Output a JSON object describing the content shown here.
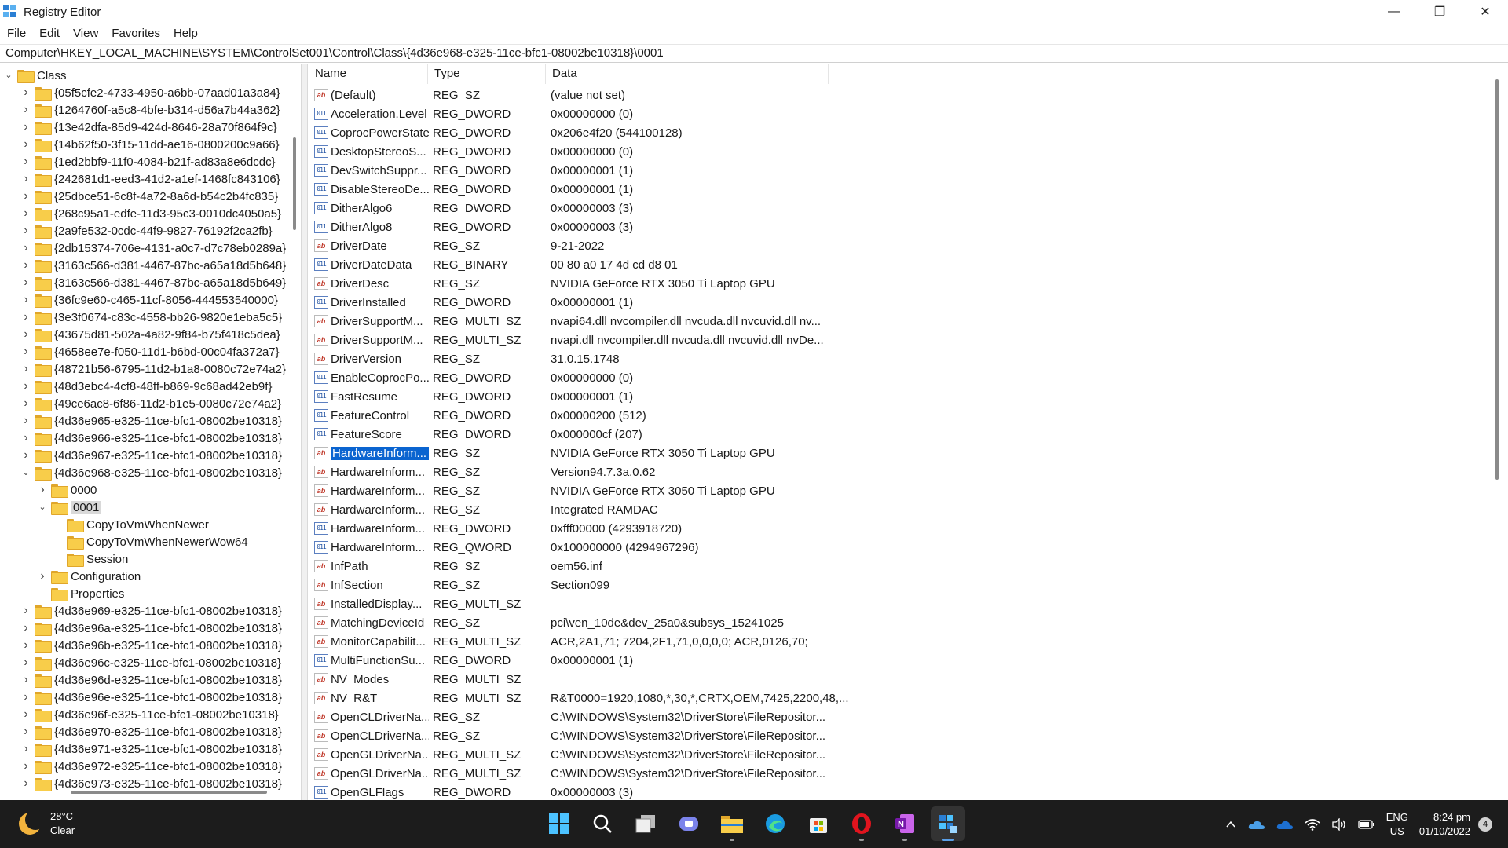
{
  "window": {
    "title": "Registry Editor",
    "controls": {
      "minimize": "—",
      "restore": "❐",
      "close": "✕"
    }
  },
  "menu": [
    "File",
    "Edit",
    "View",
    "Favorites",
    "Help"
  ],
  "address": "Computer\\HKEY_LOCAL_MACHINE\\SYSTEM\\ControlSet001\\Control\\Class\\{4d36e968-e325-11ce-bfc1-08002be10318}\\0001",
  "tree": {
    "items": [
      {
        "label": "Class",
        "level": 0,
        "expanded": true
      },
      {
        "label": "{05f5cfe2-4733-4950-a6bb-07aad01a3a84}",
        "level": 1
      },
      {
        "label": "{1264760f-a5c8-4bfe-b314-d56a7b44a362}",
        "level": 1
      },
      {
        "label": "{13e42dfa-85d9-424d-8646-28a70f864f9c}",
        "level": 1
      },
      {
        "label": "{14b62f50-3f15-11dd-ae16-0800200c9a66}",
        "level": 1
      },
      {
        "label": "{1ed2bbf9-11f0-4084-b21f-ad83a8e6dcdc}",
        "level": 1
      },
      {
        "label": "{242681d1-eed3-41d2-a1ef-1468fc843106}",
        "level": 1
      },
      {
        "label": "{25dbce51-6c8f-4a72-8a6d-b54c2b4fc835}",
        "level": 1
      },
      {
        "label": "{268c95a1-edfe-11d3-95c3-0010dc4050a5}",
        "level": 1
      },
      {
        "label": "{2a9fe532-0cdc-44f9-9827-76192f2ca2fb}",
        "level": 1
      },
      {
        "label": "{2db15374-706e-4131-a0c7-d7c78eb0289a}",
        "level": 1
      },
      {
        "label": "{3163c566-d381-4467-87bc-a65a18d5b648}",
        "level": 1
      },
      {
        "label": "{3163c566-d381-4467-87bc-a65a18d5b649}",
        "level": 1
      },
      {
        "label": "{36fc9e60-c465-11cf-8056-444553540000}",
        "level": 1
      },
      {
        "label": "{3e3f0674-c83c-4558-bb26-9820e1eba5c5}",
        "level": 1
      },
      {
        "label": "{43675d81-502a-4a82-9f84-b75f418c5dea}",
        "level": 1
      },
      {
        "label": "{4658ee7e-f050-11d1-b6bd-00c04fa372a7}",
        "level": 1
      },
      {
        "label": "{48721b56-6795-11d2-b1a8-0080c72e74a2}",
        "level": 1
      },
      {
        "label": "{48d3ebc4-4cf8-48ff-b869-9c68ad42eb9f}",
        "level": 1
      },
      {
        "label": "{49ce6ac8-6f86-11d2-b1e5-0080c72e74a2}",
        "level": 1
      },
      {
        "label": "{4d36e965-e325-11ce-bfc1-08002be10318}",
        "level": 1
      },
      {
        "label": "{4d36e966-e325-11ce-bfc1-08002be10318}",
        "level": 1
      },
      {
        "label": "{4d36e967-e325-11ce-bfc1-08002be10318}",
        "level": 1
      },
      {
        "label": "{4d36e968-e325-11ce-bfc1-08002be10318}",
        "level": 1,
        "expanded": true
      },
      {
        "label": "0000",
        "level": 2
      },
      {
        "label": "0001",
        "level": 2,
        "expanded": true,
        "selected": true
      },
      {
        "label": "CopyToVmWhenNewer",
        "level": 3,
        "leaf": true
      },
      {
        "label": "CopyToVmWhenNewerWow64",
        "level": 3,
        "leaf": true
      },
      {
        "label": "Session",
        "level": 3,
        "leaf": true
      },
      {
        "label": "Configuration",
        "level": 2
      },
      {
        "label": "Properties",
        "level": 2,
        "leaf": true
      },
      {
        "label": "{4d36e969-e325-11ce-bfc1-08002be10318}",
        "level": 1
      },
      {
        "label": "{4d36e96a-e325-11ce-bfc1-08002be10318}",
        "level": 1
      },
      {
        "label": "{4d36e96b-e325-11ce-bfc1-08002be10318}",
        "level": 1
      },
      {
        "label": "{4d36e96c-e325-11ce-bfc1-08002be10318}",
        "level": 1
      },
      {
        "label": "{4d36e96d-e325-11ce-bfc1-08002be10318}",
        "level": 1
      },
      {
        "label": "{4d36e96e-e325-11ce-bfc1-08002be10318}",
        "level": 1
      },
      {
        "label": "{4d36e96f-e325-11ce-bfc1-08002be10318}",
        "level": 1
      },
      {
        "label": "{4d36e970-e325-11ce-bfc1-08002be10318}",
        "level": 1
      },
      {
        "label": "{4d36e971-e325-11ce-bfc1-08002be10318}",
        "level": 1
      },
      {
        "label": "{4d36e972-e325-11ce-bfc1-08002be10318}",
        "level": 1
      },
      {
        "label": "{4d36e973-e325-11ce-bfc1-08002be10318}",
        "level": 1
      }
    ]
  },
  "list": {
    "columns": [
      "Name",
      "Type",
      "Data"
    ],
    "rows": [
      {
        "name": "(Default)",
        "type": "REG_SZ",
        "data": "(value not set)",
        "icon": "sz"
      },
      {
        "name": "Acceleration.Level",
        "type": "REG_DWORD",
        "data": "0x00000000 (0)",
        "icon": "bin"
      },
      {
        "name": "CoprocPowerState",
        "type": "REG_DWORD",
        "data": "0x206e4f20 (544100128)",
        "icon": "bin"
      },
      {
        "name": "DesktopStereoS...",
        "type": "REG_DWORD",
        "data": "0x00000000 (0)",
        "icon": "bin"
      },
      {
        "name": "DevSwitchSuppr...",
        "type": "REG_DWORD",
        "data": "0x00000001 (1)",
        "icon": "bin"
      },
      {
        "name": "DisableStereoDe...",
        "type": "REG_DWORD",
        "data": "0x00000001 (1)",
        "icon": "bin"
      },
      {
        "name": "DitherAlgo6",
        "type": "REG_DWORD",
        "data": "0x00000003 (3)",
        "icon": "bin"
      },
      {
        "name": "DitherAlgo8",
        "type": "REG_DWORD",
        "data": "0x00000003 (3)",
        "icon": "bin"
      },
      {
        "name": "DriverDate",
        "type": "REG_SZ",
        "data": "9-21-2022",
        "icon": "sz"
      },
      {
        "name": "DriverDateData",
        "type": "REG_BINARY",
        "data": "00 80 a0 17 4d cd d8 01",
        "icon": "bin"
      },
      {
        "name": "DriverDesc",
        "type": "REG_SZ",
        "data": "NVIDIA GeForce RTX 3050 Ti Laptop GPU",
        "icon": "sz"
      },
      {
        "name": "DriverInstalled",
        "type": "REG_DWORD",
        "data": "0x00000001 (1)",
        "icon": "bin"
      },
      {
        "name": "DriverSupportM...",
        "type": "REG_MULTI_SZ",
        "data": "nvapi64.dll nvcompiler.dll nvcuda.dll nvcuvid.dll nv...",
        "icon": "sz"
      },
      {
        "name": "DriverSupportM...",
        "type": "REG_MULTI_SZ",
        "data": "nvapi.dll nvcompiler.dll nvcuda.dll nvcuvid.dll nvDe...",
        "icon": "sz"
      },
      {
        "name": "DriverVersion",
        "type": "REG_SZ",
        "data": "31.0.15.1748",
        "icon": "sz"
      },
      {
        "name": "EnableCoprocPo...",
        "type": "REG_DWORD",
        "data": "0x00000000 (0)",
        "icon": "bin"
      },
      {
        "name": "FastResume",
        "type": "REG_DWORD",
        "data": "0x00000001 (1)",
        "icon": "bin"
      },
      {
        "name": "FeatureControl",
        "type": "REG_DWORD",
        "data": "0x00000200 (512)",
        "icon": "bin"
      },
      {
        "name": "FeatureScore",
        "type": "REG_DWORD",
        "data": "0x000000cf (207)",
        "icon": "bin"
      },
      {
        "name": "HardwareInform...",
        "type": "REG_SZ",
        "data": "NVIDIA GeForce RTX 3050 Ti Laptop GPU",
        "icon": "sz",
        "selected": true
      },
      {
        "name": "HardwareInform...",
        "type": "REG_SZ",
        "data": "Version94.7.3a.0.62",
        "icon": "sz"
      },
      {
        "name": "HardwareInform...",
        "type": "REG_SZ",
        "data": "NVIDIA GeForce RTX 3050 Ti Laptop GPU",
        "icon": "sz"
      },
      {
        "name": "HardwareInform...",
        "type": "REG_SZ",
        "data": "Integrated RAMDAC",
        "icon": "sz"
      },
      {
        "name": "HardwareInform...",
        "type": "REG_DWORD",
        "data": "0xfff00000 (4293918720)",
        "icon": "bin"
      },
      {
        "name": "HardwareInform...",
        "type": "REG_QWORD",
        "data": "0x100000000 (4294967296)",
        "icon": "bin"
      },
      {
        "name": "InfPath",
        "type": "REG_SZ",
        "data": "oem56.inf",
        "icon": "sz"
      },
      {
        "name": "InfSection",
        "type": "REG_SZ",
        "data": "Section099",
        "icon": "sz"
      },
      {
        "name": "InstalledDisplay...",
        "type": "REG_MULTI_SZ",
        "data": "",
        "icon": "sz"
      },
      {
        "name": "MatchingDeviceId",
        "type": "REG_SZ",
        "data": "pci\\ven_10de&dev_25a0&subsys_15241025",
        "icon": "sz"
      },
      {
        "name": "MonitorCapabilit...",
        "type": "REG_MULTI_SZ",
        "data": "ACR,2A1,71; 7204,2F1,71,0,0,0,0; ACR,0126,70;",
        "icon": "sz"
      },
      {
        "name": "MultiFunctionSu...",
        "type": "REG_DWORD",
        "data": "0x00000001 (1)",
        "icon": "bin"
      },
      {
        "name": "NV_Modes",
        "type": "REG_MULTI_SZ",
        "data": "",
        "icon": "sz"
      },
      {
        "name": "NV_R&T",
        "type": "REG_MULTI_SZ",
        "data": "R&T0000=1920,1080,*,30,*,CRTX,OEM,7425,2200,48,...",
        "icon": "sz"
      },
      {
        "name": "OpenCLDriverNa...",
        "type": "REG_SZ",
        "data": "C:\\WINDOWS\\System32\\DriverStore\\FileRepositor...",
        "icon": "sz"
      },
      {
        "name": "OpenCLDriverNa...",
        "type": "REG_SZ",
        "data": "C:\\WINDOWS\\System32\\DriverStore\\FileRepositor...",
        "icon": "sz"
      },
      {
        "name": "OpenGLDriverNa...",
        "type": "REG_MULTI_SZ",
        "data": "C:\\WINDOWS\\System32\\DriverStore\\FileRepositor...",
        "icon": "sz"
      },
      {
        "name": "OpenGLDriverNa...",
        "type": "REG_MULTI_SZ",
        "data": "C:\\WINDOWS\\System32\\DriverStore\\FileRepositor...",
        "icon": "sz"
      },
      {
        "name": "OpenGLFlags",
        "type": "REG_DWORD",
        "data": "0x00000003 (3)",
        "icon": "bin"
      }
    ]
  },
  "taskbar": {
    "weather": {
      "temp": "28°C",
      "condition": "Clear"
    },
    "apps": [
      {
        "name": "start-icon",
        "glyph": "start"
      },
      {
        "name": "search-icon",
        "glyph": "search"
      },
      {
        "name": "task-view-icon",
        "glyph": "taskview"
      },
      {
        "name": "chat-icon",
        "glyph": "chat"
      },
      {
        "name": "file-explorer-icon",
        "glyph": "explorer"
      },
      {
        "name": "edge-icon",
        "glyph": "edge"
      },
      {
        "name": "store-icon",
        "glyph": "store"
      },
      {
        "name": "opera-icon",
        "glyph": "opera"
      },
      {
        "name": "onenote-icon",
        "glyph": "onenote"
      },
      {
        "name": "regedit-icon",
        "glyph": "regedit"
      }
    ],
    "tray": {
      "language": "ENG",
      "region": "US",
      "time": "8:24 pm",
      "date": "01/10/2022",
      "notifications": "4"
    }
  },
  "colors": {
    "selection": "#0a64d0",
    "taskbar": "#1c1c1c",
    "folder": "#f8cd4a",
    "accent": "#5aa0e8"
  }
}
